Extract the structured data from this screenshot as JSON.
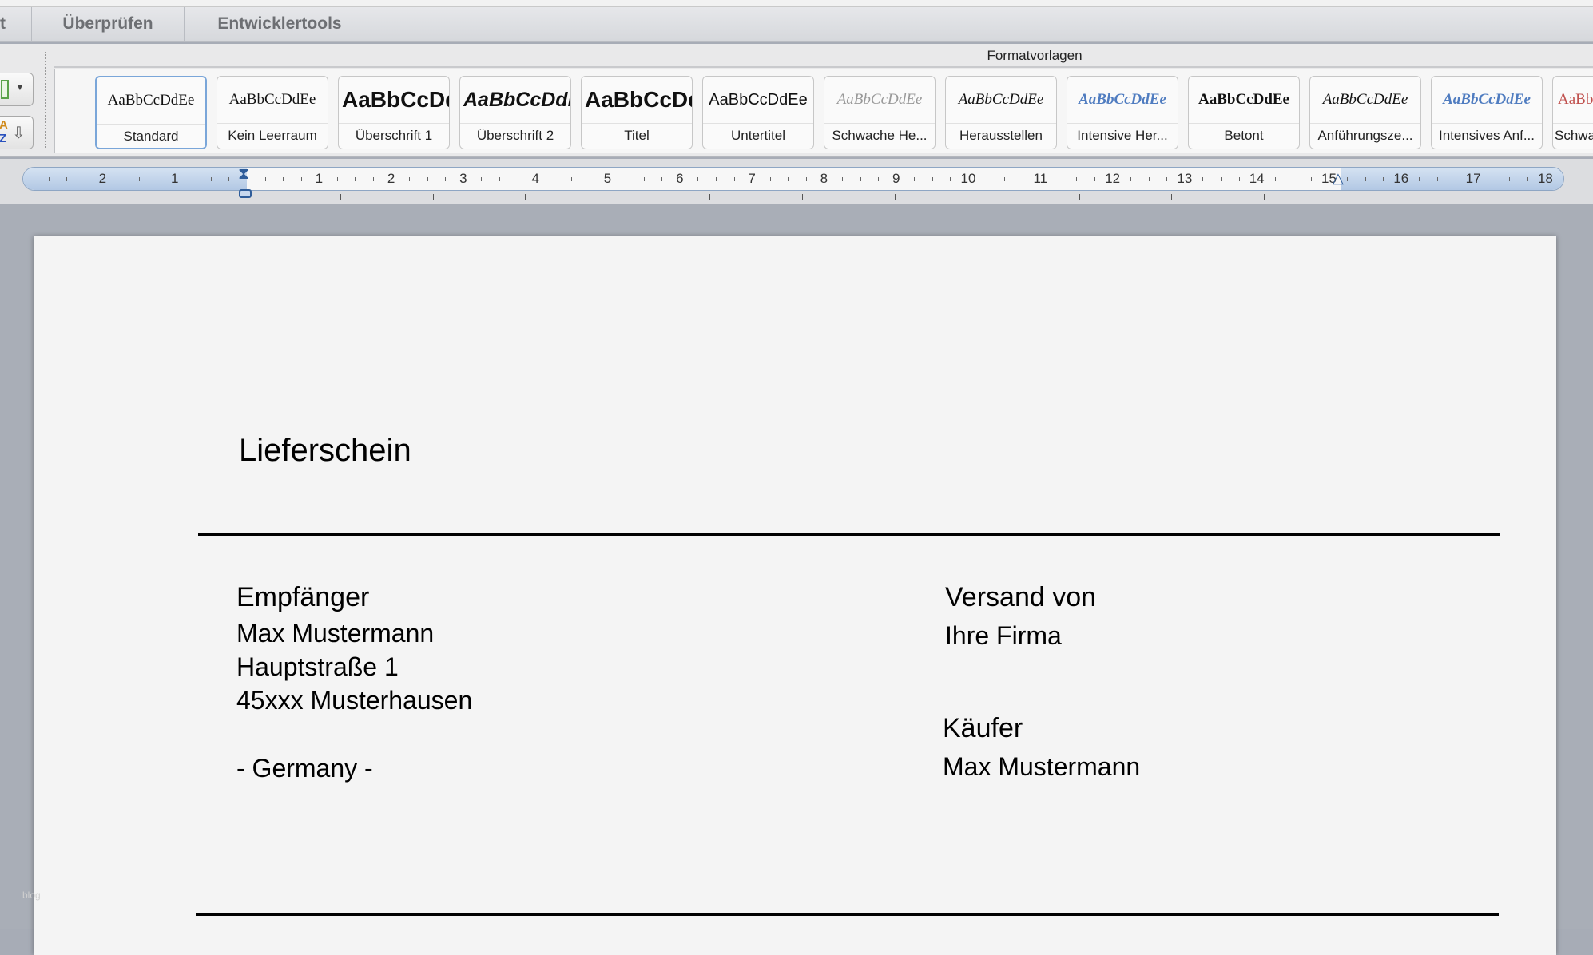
{
  "tabs": [
    {
      "label": "t"
    },
    {
      "label": "Überprüfen"
    },
    {
      "label": "Entwicklertools"
    }
  ],
  "ribbon": {
    "group_label": "Formatvorlagen",
    "styles": [
      {
        "sample": "AaBbCcDdEe",
        "label": "Standard",
        "selected": true
      },
      {
        "sample": "AaBbCcDdEe",
        "label": "Kein Leerraum"
      },
      {
        "sample": "AaBbCcDd",
        "label": "Überschrift 1"
      },
      {
        "sample": "AaBbCcDdE",
        "label": "Überschrift 2"
      },
      {
        "sample": "AaBbCcDd",
        "label": "Titel"
      },
      {
        "sample": "AaBbCcDdEe",
        "label": "Untertitel"
      },
      {
        "sample": "AaBbCcDdEe",
        "label": "Schwache He..."
      },
      {
        "sample": "AaBbCcDdEe",
        "label": "Herausstellen"
      },
      {
        "sample": "AaBbCcDdEe",
        "label": "Intensive Her..."
      },
      {
        "sample": "AaBbCcDdEe",
        "label": "Betont"
      },
      {
        "sample": "AaBbCcDdEe",
        "label": "Anführungsze..."
      },
      {
        "sample": "AaBbCcDdEe",
        "label": "Intensives Anf..."
      },
      {
        "sample": "AaBb",
        "label": "Schwa"
      }
    ]
  },
  "ruler": {
    "left_numbers": [
      "2",
      "1"
    ],
    "right_numbers": [
      "1",
      "2",
      "3",
      "4",
      "5",
      "6",
      "7",
      "8",
      "9",
      "10",
      "11",
      "12",
      "13",
      "14",
      "15",
      "16",
      "17",
      "18"
    ]
  },
  "document": {
    "title": "Lieferschein",
    "recipient": {
      "heading": "Empfänger",
      "name": "Max Mustermann",
      "street": "Hauptstraße 1",
      "city": "45xxx Musterhausen",
      "country": "- Germany -"
    },
    "sender": {
      "heading": "Versand von",
      "name": "Ihre Firma"
    },
    "buyer": {
      "heading": "Käufer",
      "name": "Max Mustermann"
    },
    "watermark": "blog"
  },
  "colors": {
    "selection": "#7aa6d9",
    "ruler_blue": "#b2c8e4",
    "intensive_blue": "#4f7cc0",
    "red_accent": "#c0504d"
  }
}
